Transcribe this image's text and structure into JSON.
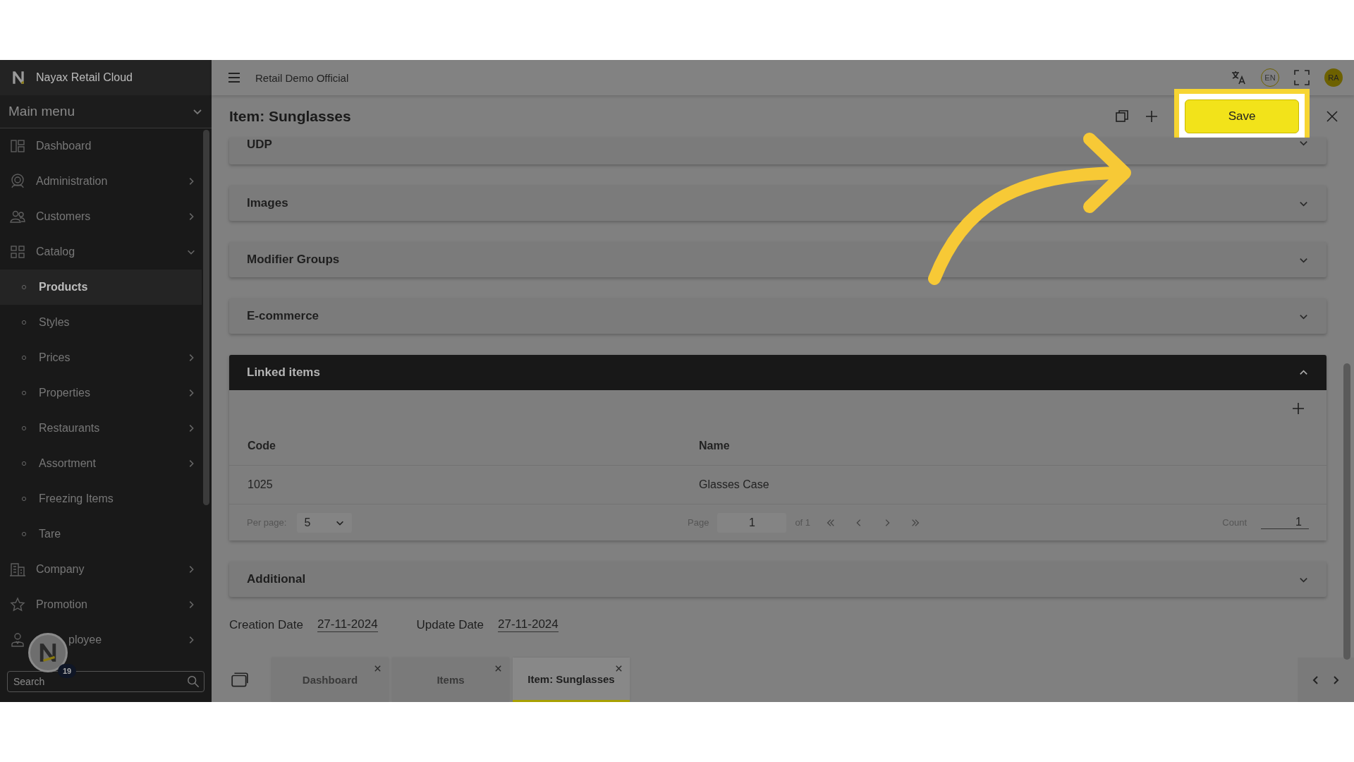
{
  "app": {
    "title": "Nayax Retail Cloud"
  },
  "sidebar": {
    "menu_title": "Main menu",
    "search": {
      "placeholder": "Search"
    },
    "items": [
      {
        "label": "Dashboard",
        "has_children": false,
        "selected": false
      },
      {
        "label": "Administration",
        "has_children": true,
        "expanded": false,
        "selected": false
      },
      {
        "label": "Customers",
        "has_children": true,
        "expanded": false,
        "selected": false
      },
      {
        "label": "Catalog",
        "has_children": true,
        "expanded": true,
        "selected": false,
        "children": [
          {
            "label": "Products",
            "has_children": false,
            "selected": true
          },
          {
            "label": "Styles",
            "has_children": false,
            "selected": false
          },
          {
            "label": "Prices",
            "has_children": true,
            "selected": false
          },
          {
            "label": "Properties",
            "has_children": true,
            "selected": false
          },
          {
            "label": "Restaurants",
            "has_children": true,
            "selected": false
          },
          {
            "label": "Assortment",
            "has_children": true,
            "selected": false
          },
          {
            "label": "Freezing Items",
            "has_children": false,
            "selected": false
          },
          {
            "label": "Tare",
            "has_children": false,
            "selected": false
          }
        ]
      },
      {
        "label": "Company",
        "has_children": true,
        "expanded": false,
        "selected": false
      },
      {
        "label": "Promotion",
        "has_children": true,
        "expanded": false,
        "selected": false
      },
      {
        "label": "ployee",
        "has_children": true,
        "expanded": false,
        "selected": false
      }
    ]
  },
  "floating_badge": {
    "count": "19"
  },
  "topbar": {
    "title": "Retail Demo Official",
    "language": "EN",
    "avatar": "RA"
  },
  "page": {
    "title": "Item: Sunglasses",
    "save_button": {
      "label": "Save",
      "highlighted": true
    }
  },
  "sections": [
    {
      "title": "UDP",
      "expanded": false
    },
    {
      "title": "Images",
      "expanded": false
    },
    {
      "title": "Modifier Groups",
      "expanded": false
    },
    {
      "title": "E-commerce",
      "expanded": false
    },
    {
      "title": "Linked items",
      "expanded": true,
      "table": {
        "columns": [
          "Code",
          "Name"
        ],
        "rows": [
          [
            "1025",
            "Glasses Case"
          ]
        ],
        "per_page_label": "Per page:",
        "per_page": "5",
        "page_label": "Page",
        "page": "1",
        "page_total": "of 1",
        "count_label": "Count",
        "count": "1"
      }
    },
    {
      "title": "Additional",
      "expanded": false
    }
  ],
  "dates": [
    {
      "label": "Creation Date",
      "value": "27-11-2024"
    },
    {
      "label": "Update Date",
      "value": "27-11-2024"
    }
  ],
  "tabs": [
    {
      "label": "Dashboard",
      "selected": false
    },
    {
      "label": "Items",
      "selected": false
    },
    {
      "label": "Item: Sunglasses",
      "selected": true
    }
  ]
}
